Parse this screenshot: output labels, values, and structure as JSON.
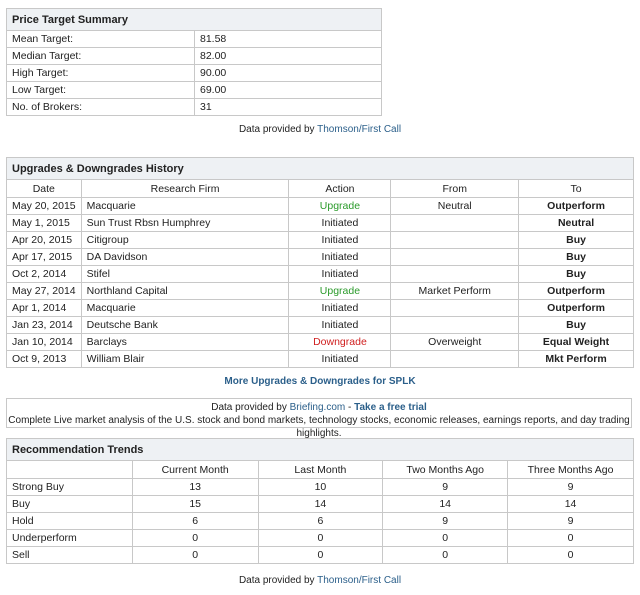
{
  "price_target": {
    "title": "Price Target Summary",
    "rows": [
      [
        "Mean Target:",
        "81.58"
      ],
      [
        "Median Target:",
        "82.00"
      ],
      [
        "High Target:",
        "90.00"
      ],
      [
        "Low Target:",
        "69.00"
      ],
      [
        "No. of Brokers:",
        "31"
      ]
    ],
    "note_prefix": "Data provided by ",
    "note_link": "Thomson/First Call"
  },
  "upgrades": {
    "title": "Upgrades & Downgrades History",
    "headers": [
      "Date",
      "Research Firm",
      "Action",
      "From",
      "To"
    ],
    "rows": [
      [
        "May 20, 2015",
        "Macquarie",
        "Upgrade",
        "Neutral",
        "Outperform"
      ],
      [
        "May 1, 2015",
        "Sun Trust Rbsn Humphrey",
        "Initiated",
        "",
        "Neutral"
      ],
      [
        "Apr 20, 2015",
        "Citigroup",
        "Initiated",
        "",
        "Buy"
      ],
      [
        "Apr 17, 2015",
        "DA Davidson",
        "Initiated",
        "",
        "Buy"
      ],
      [
        "Oct 2, 2014",
        "Stifel",
        "Initiated",
        "",
        "Buy"
      ],
      [
        "May 27, 2014",
        "Northland Capital",
        "Upgrade",
        "Market Perform",
        "Outperform"
      ],
      [
        "Apr 1, 2014",
        "Macquarie",
        "Initiated",
        "",
        "Outperform"
      ],
      [
        "Jan 23, 2014",
        "Deutsche Bank",
        "Initiated",
        "",
        "Buy"
      ],
      [
        "Jan 10, 2014",
        "Barclays",
        "Downgrade",
        "Overweight",
        "Equal Weight"
      ],
      [
        "Oct 9, 2013",
        "William Blair",
        "Initiated",
        "",
        "Mkt Perform"
      ]
    ],
    "more_link": "More Upgrades & Downgrades for SPLK"
  },
  "briefing": {
    "prefix": "Data provided by ",
    "link": "Briefing.com",
    "sep": " - ",
    "trial": "Take a free trial",
    "desc": "Complete Live market analysis of the U.S. stock and bond markets, technology stocks, economic releases, earnings reports, and day trading highlights."
  },
  "trends": {
    "title": "Recommendation Trends",
    "headers": [
      "",
      "Current Month",
      "Last Month",
      "Two Months Ago",
      "Three Months Ago"
    ],
    "rows": [
      [
        "Strong Buy",
        "13",
        "10",
        "9",
        "9"
      ],
      [
        "Buy",
        "15",
        "14",
        "14",
        "14"
      ],
      [
        "Hold",
        "6",
        "6",
        "9",
        "9"
      ],
      [
        "Underperform",
        "0",
        "0",
        "0",
        "0"
      ],
      [
        "Sell",
        "0",
        "0",
        "0",
        "0"
      ]
    ],
    "note_prefix": "Data provided by ",
    "note_link": "Thomson/First Call"
  }
}
